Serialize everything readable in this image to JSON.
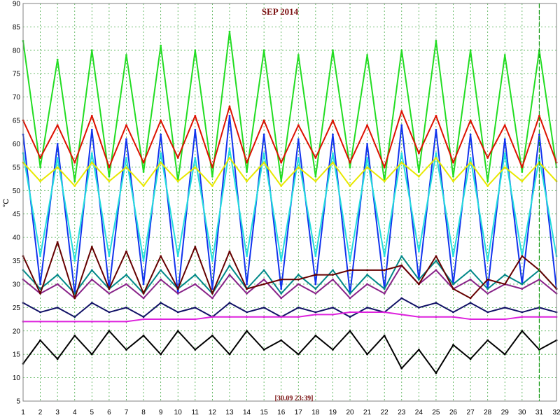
{
  "chart_data": {
    "type": "line",
    "title": "SEP 2014",
    "ylabel": "°C",
    "xlabel": "",
    "timestamp": "[30.09 23:39]",
    "xlim": [
      1,
      32
    ],
    "ylim": [
      5,
      90
    ],
    "x_ticks": [
      1,
      2,
      3,
      4,
      5,
      6,
      7,
      8,
      9,
      10,
      11,
      12,
      13,
      14,
      15,
      16,
      17,
      18,
      19,
      20,
      21,
      22,
      23,
      24,
      25,
      26,
      27,
      28,
      29,
      30,
      31,
      32
    ],
    "y_ticks": [
      5,
      10,
      15,
      20,
      25,
      30,
      35,
      40,
      45,
      50,
      55,
      60,
      65,
      70,
      75,
      80,
      85,
      90
    ],
    "grid": true,
    "current_marker_x": 31,
    "series": [
      {
        "color": "#22dd22",
        "values": [
          82,
          55,
          78,
          52,
          80,
          53,
          79,
          54,
          81,
          52,
          80,
          53,
          84,
          54,
          80,
          52,
          79,
          53,
          80,
          55,
          79,
          52,
          80,
          54,
          82,
          53,
          80,
          52,
          79,
          54,
          80,
          55
        ]
      },
      {
        "color": "#dd1100",
        "values": [
          65,
          57,
          64,
          56,
          66,
          55,
          64,
          56,
          65,
          57,
          66,
          55,
          68,
          56,
          65,
          56,
          64,
          57,
          65,
          56,
          64,
          55,
          67,
          58,
          66,
          56,
          65,
          57,
          64,
          55,
          66,
          56
        ]
      },
      {
        "color": "#1133ee",
        "values": [
          62,
          30,
          60,
          28,
          63,
          29,
          61,
          30,
          62,
          28,
          63,
          29,
          66,
          30,
          62,
          29,
          61,
          30,
          62,
          28,
          60,
          29,
          64,
          31,
          63,
          30,
          62,
          29,
          61,
          30,
          62,
          29
        ]
      },
      {
        "color": "#22dddd",
        "values": [
          58,
          36,
          57,
          35,
          58,
          36,
          57,
          35,
          58,
          36,
          57,
          35,
          59,
          36,
          58,
          35,
          57,
          36,
          58,
          35,
          57,
          36,
          58,
          37,
          58,
          36,
          57,
          35,
          58,
          36,
          57,
          36
        ]
      },
      {
        "color": "#e8e800",
        "values": [
          56,
          52,
          55,
          51,
          56,
          52,
          55,
          51,
          56,
          52,
          55,
          51,
          57,
          52,
          56,
          51,
          55,
          52,
          56,
          51,
          55,
          52,
          56,
          53,
          57,
          52,
          56,
          51,
          55,
          52,
          56,
          52
        ]
      },
      {
        "color": "#008888",
        "values": [
          33,
          29,
          32,
          28,
          33,
          29,
          32,
          28,
          33,
          29,
          32,
          28,
          34,
          29,
          33,
          28,
          32,
          29,
          33,
          28,
          32,
          29,
          36,
          31,
          35,
          30,
          33,
          29,
          32,
          30,
          33,
          29
        ]
      },
      {
        "color": "#882288",
        "values": [
          31,
          28,
          30,
          27,
          31,
          28,
          30,
          27,
          31,
          28,
          30,
          27,
          32,
          28,
          31,
          27,
          30,
          28,
          31,
          27,
          30,
          28,
          34,
          30,
          33,
          29,
          31,
          28,
          30,
          29,
          31,
          28
        ]
      },
      {
        "color": "#111166",
        "values": [
          26,
          24,
          25,
          23,
          26,
          24,
          25,
          23,
          26,
          24,
          25,
          23,
          26,
          24,
          25,
          23,
          25,
          24,
          25,
          23,
          25,
          24,
          27,
          25,
          26,
          24,
          26,
          24,
          25,
          24,
          25,
          24
        ]
      },
      {
        "color": "#dd22dd",
        "values": [
          22,
          22,
          22,
          22,
          22,
          22,
          22,
          22.5,
          22.5,
          22.5,
          22.5,
          23,
          23,
          23,
          23,
          23,
          23,
          23.5,
          23.5,
          24,
          24,
          24,
          23.5,
          23,
          23,
          23,
          22.5,
          22.5,
          22.5,
          23,
          23,
          23
        ]
      },
      {
        "color": "#000000",
        "values": [
          13,
          18,
          14,
          19,
          15,
          20,
          16,
          19,
          15,
          20,
          16,
          19,
          15,
          20,
          16,
          18,
          15,
          19,
          16,
          20,
          15,
          19,
          12,
          16,
          11,
          17,
          14,
          18,
          15,
          20,
          16,
          18
        ]
      },
      {
        "color": "#660000",
        "values": [
          36,
          28,
          39,
          27,
          38,
          29,
          37,
          28,
          36,
          29,
          38,
          28,
          37,
          29,
          30,
          31,
          31,
          32,
          32,
          33,
          33,
          33,
          34,
          30,
          36,
          29,
          27,
          31,
          30,
          36,
          33,
          29
        ]
      }
    ]
  }
}
